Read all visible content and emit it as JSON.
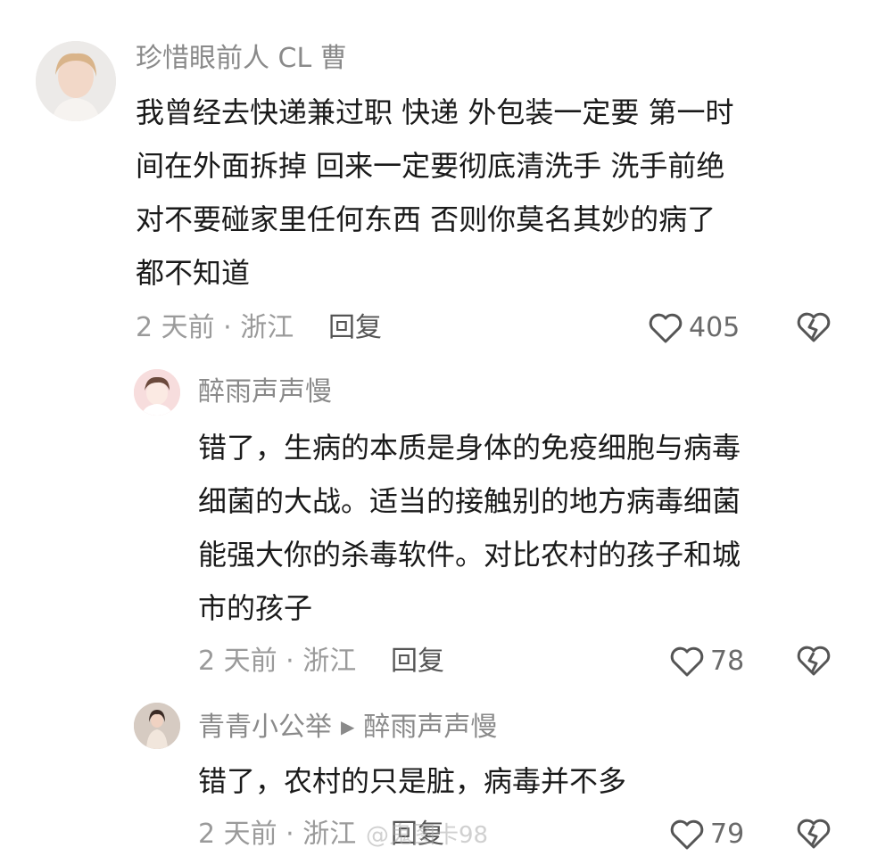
{
  "comments": [
    {
      "username": "珍惜眼前人 CL 曹",
      "lines": [
        "我曾经去快递兼过职  快递 外包装一定要 第一时",
        "间在外面拆掉 回来一定要彻底清洗手  洗手前绝",
        "对不要碰家里任何东西  否则你莫名其妙的病了",
        "都不知道"
      ],
      "meta": "2 天前 · 浙江",
      "reply_label": "回复",
      "likes": "405"
    },
    {
      "username": "醉雨声声慢",
      "lines": [
        "错了，生病的本质是身体的免疫细胞与病毒",
        "细菌的大战。适当的接触别的地方病毒细菌",
        "能强大你的杀毒软件。对比农村的孩子和城",
        "市的孩子"
      ],
      "meta": "2 天前 · 浙江",
      "reply_label": "回复",
      "likes": "78"
    },
    {
      "username": "青青小公举",
      "reply_to": "醉雨声声慢",
      "lines": [
        "错了，农村的只是脏，病毒并不多"
      ],
      "meta": "2 天前 · 浙江",
      "reply_label": "回复",
      "likes": "79"
    }
  ],
  "watermark": "@鬼图卡98",
  "icons": {
    "like": "heart-outline-icon",
    "dislike": "broken-heart-icon",
    "reply_arrow": "play-arrow-icon"
  },
  "colors": {
    "text": "#1a1a1a",
    "secondary": "#8a8a8a",
    "icon": "#555555"
  }
}
